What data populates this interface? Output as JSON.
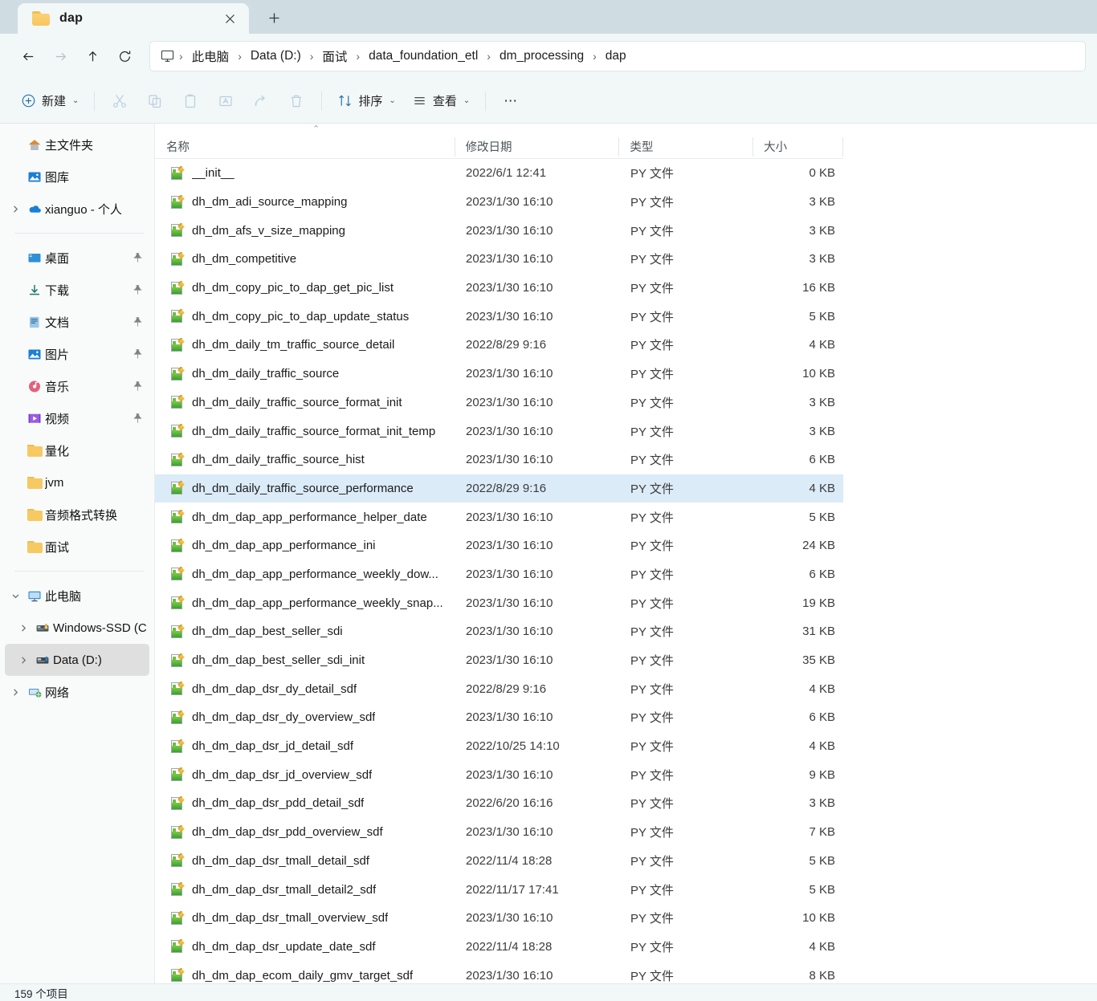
{
  "window": {
    "tab_title": "dap",
    "tab_close_label": "✕",
    "new_tab_label": "+"
  },
  "nav_buttons": {
    "back": "←",
    "forward": "→",
    "up": "↑",
    "refresh": "↻"
  },
  "address": {
    "pc_icon": "monitor-icon",
    "separator": "›",
    "crumbs": [
      "此电脑",
      "Data (D:)",
      "面试",
      "data_foundation_etl",
      "dm_processing",
      "dap"
    ]
  },
  "commandbar": {
    "new_label": "新建",
    "sort_label": "排序",
    "view_label": "查看",
    "more_label": "•••",
    "caret": "⌄",
    "icon_buttons": [
      {
        "name": "cut-button",
        "icon": "scissors-icon"
      },
      {
        "name": "copy-button",
        "icon": "copy-icon"
      },
      {
        "name": "paste-button",
        "icon": "clipboard-icon"
      },
      {
        "name": "rename-button",
        "icon": "rename-icon"
      },
      {
        "name": "share-button",
        "icon": "share-icon"
      },
      {
        "name": "delete-button",
        "icon": "trash-icon"
      }
    ]
  },
  "sidebar": {
    "items": [
      {
        "label": "主文件夹",
        "icon": "home-icon",
        "chevron": false,
        "pin": false,
        "indent": 0,
        "selected": false
      },
      {
        "label": "图库",
        "icon": "gallery-icon",
        "chevron": false,
        "pin": false,
        "indent": 0,
        "selected": false
      },
      {
        "label": "xianguo - 个人",
        "icon": "onedrive-icon",
        "chevron": true,
        "pin": false,
        "indent": 0,
        "selected": false
      },
      {
        "separator": true
      },
      {
        "label": "桌面",
        "icon": "desktop-icon",
        "chevron": false,
        "pin": true,
        "indent": 0,
        "selected": false
      },
      {
        "label": "下载",
        "icon": "downloads-icon",
        "chevron": false,
        "pin": true,
        "indent": 0,
        "selected": false
      },
      {
        "label": "文档",
        "icon": "documents-icon",
        "chevron": false,
        "pin": true,
        "indent": 0,
        "selected": false
      },
      {
        "label": "图片",
        "icon": "pictures-icon",
        "chevron": false,
        "pin": true,
        "indent": 0,
        "selected": false
      },
      {
        "label": "音乐",
        "icon": "music-icon",
        "chevron": false,
        "pin": true,
        "indent": 0,
        "selected": false
      },
      {
        "label": "视频",
        "icon": "videos-icon",
        "chevron": false,
        "pin": true,
        "indent": 0,
        "selected": false
      },
      {
        "label": "量化",
        "icon": "folder-icon",
        "chevron": false,
        "pin": false,
        "indent": 0,
        "selected": false
      },
      {
        "label": "jvm",
        "icon": "folder-icon",
        "chevron": false,
        "pin": false,
        "indent": 0,
        "selected": false
      },
      {
        "label": "音频格式转换",
        "icon": "folder-icon",
        "chevron": false,
        "pin": false,
        "indent": 0,
        "selected": false
      },
      {
        "label": "面试",
        "icon": "folder-icon",
        "chevron": false,
        "pin": false,
        "indent": 0,
        "selected": false
      },
      {
        "separator": true
      },
      {
        "label": "此电脑",
        "icon": "thispc-icon",
        "chevron": true,
        "expanded": true,
        "pin": false,
        "indent": 0,
        "selected": false
      },
      {
        "label": "Windows-SSD (C",
        "icon": "ssd-drive-icon",
        "chevron": true,
        "pin": false,
        "indent": 1,
        "selected": false
      },
      {
        "label": "Data (D:)",
        "icon": "drive-icon",
        "chevron": true,
        "pin": false,
        "indent": 1,
        "selected": true
      },
      {
        "label": "网络",
        "icon": "network-icon",
        "chevron": true,
        "pin": false,
        "indent": 0,
        "selected": false
      }
    ]
  },
  "list": {
    "sort_indicator": "⌃",
    "columns": [
      {
        "key": "name",
        "label": "名称"
      },
      {
        "key": "date",
        "label": "修改日期"
      },
      {
        "key": "type",
        "label": "类型"
      },
      {
        "key": "size",
        "label": "大小"
      }
    ],
    "file_icon": "python-file-icon",
    "rows": [
      {
        "name": "__init__",
        "date": "2022/6/1 12:41",
        "type": "PY 文件",
        "size": "0 KB",
        "selected": false
      },
      {
        "name": "dh_dm_adi_source_mapping",
        "date": "2023/1/30 16:10",
        "type": "PY 文件",
        "size": "3 KB",
        "selected": false
      },
      {
        "name": "dh_dm_afs_v_size_mapping",
        "date": "2023/1/30 16:10",
        "type": "PY 文件",
        "size": "3 KB",
        "selected": false
      },
      {
        "name": "dh_dm_competitive",
        "date": "2023/1/30 16:10",
        "type": "PY 文件",
        "size": "3 KB",
        "selected": false
      },
      {
        "name": "dh_dm_copy_pic_to_dap_get_pic_list",
        "date": "2023/1/30 16:10",
        "type": "PY 文件",
        "size": "16 KB",
        "selected": false
      },
      {
        "name": "dh_dm_copy_pic_to_dap_update_status",
        "date": "2023/1/30 16:10",
        "type": "PY 文件",
        "size": "5 KB",
        "selected": false
      },
      {
        "name": "dh_dm_daily_tm_traffic_source_detail",
        "date": "2022/8/29 9:16",
        "type": "PY 文件",
        "size": "4 KB",
        "selected": false
      },
      {
        "name": "dh_dm_daily_traffic_source",
        "date": "2023/1/30 16:10",
        "type": "PY 文件",
        "size": "10 KB",
        "selected": false
      },
      {
        "name": "dh_dm_daily_traffic_source_format_init",
        "date": "2023/1/30 16:10",
        "type": "PY 文件",
        "size": "3 KB",
        "selected": false
      },
      {
        "name": "dh_dm_daily_traffic_source_format_init_temp",
        "date": "2023/1/30 16:10",
        "type": "PY 文件",
        "size": "3 KB",
        "selected": false
      },
      {
        "name": "dh_dm_daily_traffic_source_hist",
        "date": "2023/1/30 16:10",
        "type": "PY 文件",
        "size": "6 KB",
        "selected": false
      },
      {
        "name": "dh_dm_daily_traffic_source_performance",
        "date": "2022/8/29 9:16",
        "type": "PY 文件",
        "size": "4 KB",
        "selected": true
      },
      {
        "name": "dh_dm_dap_app_performance_helper_date",
        "date": "2023/1/30 16:10",
        "type": "PY 文件",
        "size": "5 KB",
        "selected": false
      },
      {
        "name": "dh_dm_dap_app_performance_ini",
        "date": "2023/1/30 16:10",
        "type": "PY 文件",
        "size": "24 KB",
        "selected": false
      },
      {
        "name": "dh_dm_dap_app_performance_weekly_dow...",
        "date": "2023/1/30 16:10",
        "type": "PY 文件",
        "size": "6 KB",
        "selected": false
      },
      {
        "name": "dh_dm_dap_app_performance_weekly_snap...",
        "date": "2023/1/30 16:10",
        "type": "PY 文件",
        "size": "19 KB",
        "selected": false
      },
      {
        "name": "dh_dm_dap_best_seller_sdi",
        "date": "2023/1/30 16:10",
        "type": "PY 文件",
        "size": "31 KB",
        "selected": false
      },
      {
        "name": "dh_dm_dap_best_seller_sdi_init",
        "date": "2023/1/30 16:10",
        "type": "PY 文件",
        "size": "35 KB",
        "selected": false
      },
      {
        "name": "dh_dm_dap_dsr_dy_detail_sdf",
        "date": "2022/8/29 9:16",
        "type": "PY 文件",
        "size": "4 KB",
        "selected": false
      },
      {
        "name": "dh_dm_dap_dsr_dy_overview_sdf",
        "date": "2023/1/30 16:10",
        "type": "PY 文件",
        "size": "6 KB",
        "selected": false
      },
      {
        "name": "dh_dm_dap_dsr_jd_detail_sdf",
        "date": "2022/10/25 14:10",
        "type": "PY 文件",
        "size": "4 KB",
        "selected": false
      },
      {
        "name": "dh_dm_dap_dsr_jd_overview_sdf",
        "date": "2023/1/30 16:10",
        "type": "PY 文件",
        "size": "9 KB",
        "selected": false
      },
      {
        "name": "dh_dm_dap_dsr_pdd_detail_sdf",
        "date": "2022/6/20 16:16",
        "type": "PY 文件",
        "size": "3 KB",
        "selected": false
      },
      {
        "name": "dh_dm_dap_dsr_pdd_overview_sdf",
        "date": "2023/1/30 16:10",
        "type": "PY 文件",
        "size": "7 KB",
        "selected": false
      },
      {
        "name": "dh_dm_dap_dsr_tmall_detail_sdf",
        "date": "2022/11/4 18:28",
        "type": "PY 文件",
        "size": "5 KB",
        "selected": false
      },
      {
        "name": "dh_dm_dap_dsr_tmall_detail2_sdf",
        "date": "2022/11/17 17:41",
        "type": "PY 文件",
        "size": "5 KB",
        "selected": false
      },
      {
        "name": "dh_dm_dap_dsr_tmall_overview_sdf",
        "date": "2023/1/30 16:10",
        "type": "PY 文件",
        "size": "10 KB",
        "selected": false
      },
      {
        "name": "dh_dm_dap_dsr_update_date_sdf",
        "date": "2022/11/4 18:28",
        "type": "PY 文件",
        "size": "4 KB",
        "selected": false
      },
      {
        "name": "dh_dm_dap_ecom_daily_gmv_target_sdf",
        "date": "2023/1/30 16:10",
        "type": "PY 文件",
        "size": "8 KB",
        "selected": false
      }
    ]
  },
  "statusbar": {
    "item_count": "159 个项目"
  },
  "colors": {
    "titlebar": "#cfdde2",
    "chrome": "#f2f7f8",
    "selection": "#dbebf8",
    "nav_selection": "#dfdfdf",
    "folder_yellow": "#f6c963",
    "accent_text": "#1b1b1b"
  }
}
